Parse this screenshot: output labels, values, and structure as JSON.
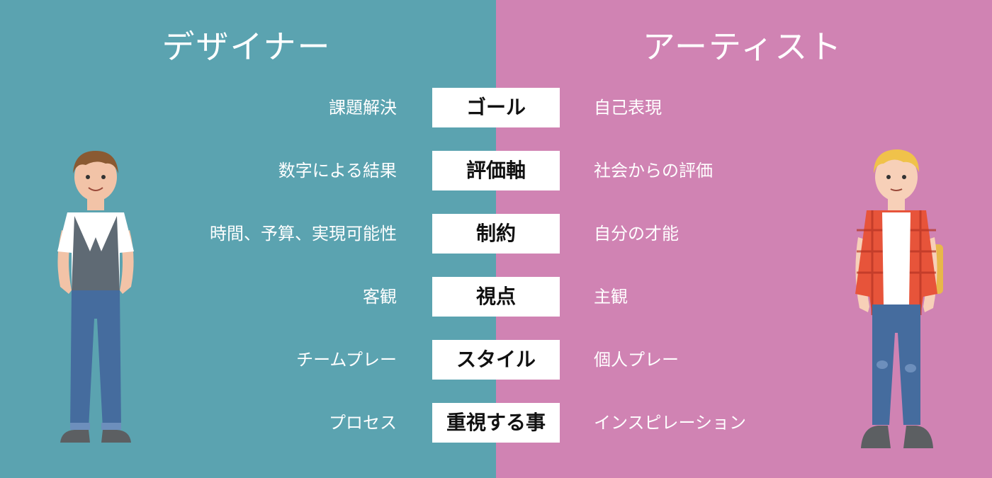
{
  "designer": {
    "title": "デザイナー",
    "items": [
      "課題解決",
      "数字による結果",
      "時間、予算、実現可能性",
      "客観",
      "チームプレー",
      "プロセス"
    ]
  },
  "artist": {
    "title": "アーティスト",
    "items": [
      "自己表現",
      "社会からの評価",
      "自分の才能",
      "主観",
      "個人プレー",
      "インスピレーション"
    ]
  },
  "categories": [
    "ゴール",
    "評価軸",
    "制約",
    "視点",
    "スタイル",
    "重視する事"
  ],
  "colors": {
    "designer_bg": "#5ba3b0",
    "artist_bg": "#d083b3",
    "box_bg": "#ffffff"
  }
}
